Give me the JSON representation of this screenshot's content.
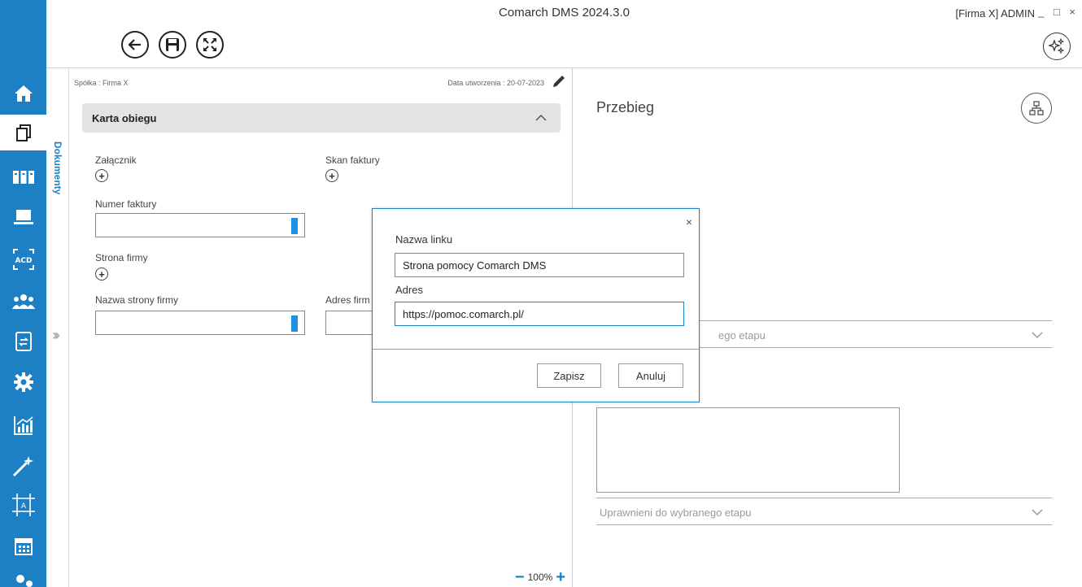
{
  "app": {
    "title": "Comarch DMS 2024.3.0",
    "company_user": "[Firma X]  ADMIN",
    "window_controls": "_ □ ×"
  },
  "sidebar": {
    "items": [
      {
        "name": "home-icon"
      },
      {
        "name": "documents-icon"
      },
      {
        "name": "repository-icon"
      },
      {
        "name": "workstation-icon"
      },
      {
        "name": "ocr-icon"
      },
      {
        "name": "users-icon"
      },
      {
        "name": "document-flow-icon"
      },
      {
        "name": "settings-icon"
      },
      {
        "name": "reports-icon"
      },
      {
        "name": "magic-wand-icon"
      },
      {
        "name": "designer-icon"
      },
      {
        "name": "calendar-icon"
      },
      {
        "name": "user-settings-icon"
      }
    ]
  },
  "vertical_tab": {
    "label": "Dokumenty"
  },
  "document": {
    "company": "Spółka : Firma X",
    "created": "Data utworzenia : 20-07-2023",
    "section_title": "Karta obiegu",
    "fields": {
      "zalacznik": "Załącznik",
      "skan_faktury": "Skan faktury",
      "numer_faktury": "Numer faktury",
      "strona_firmy": "Strona firmy",
      "nazwa_strony_firmy": "Nazwa strony firmy",
      "adres_firmy": "Adres firm"
    },
    "zoom": {
      "minus": "−",
      "value": "100%",
      "plus": "+"
    }
  },
  "right": {
    "title": "Przebieg",
    "dropdown1": "ego etapu",
    "dropdown2": "Uprawnieni do wybranego etapu"
  },
  "modal": {
    "close": "×",
    "link_name_label": "Nazwa linku",
    "link_name_value": "Strona pomocy Comarch DMS",
    "address_label": "Adres",
    "address_value": "https://pomoc.comarch.pl/",
    "save_label": "Zapisz",
    "cancel_label": "Anuluj"
  },
  "colors": {
    "accent": "#1d7fc4",
    "input_marker": "#1e90e0",
    "section_bg": "#e3e3e3"
  }
}
